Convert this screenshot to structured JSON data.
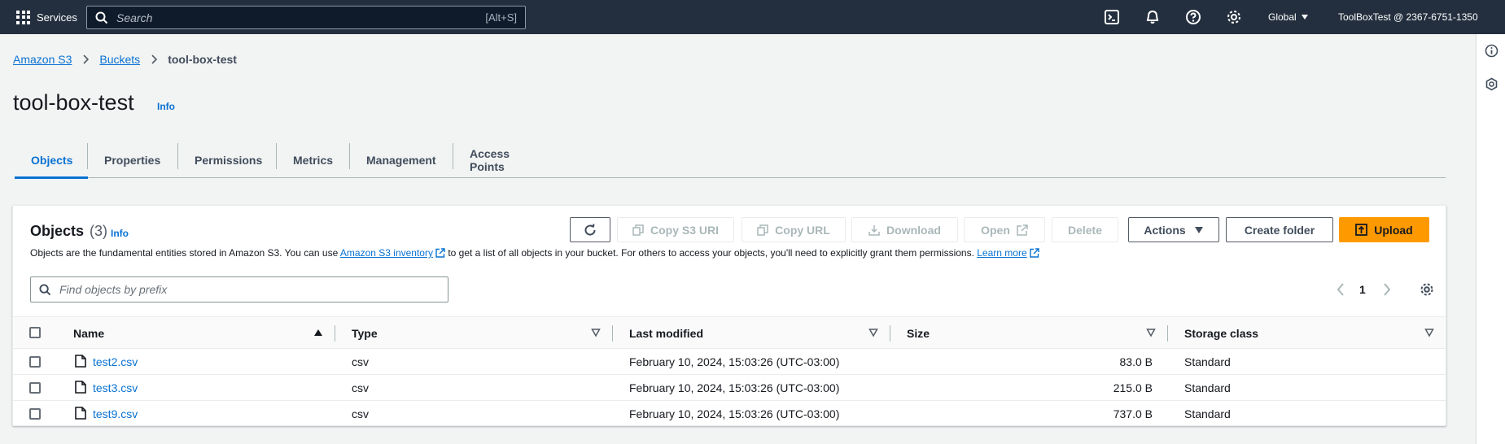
{
  "topnav": {
    "services_label": "Services",
    "search_placeholder": "Search",
    "search_shortcut": "[Alt+S]",
    "region": "Global",
    "account": "ToolBoxTest @ 2367-6751-1350"
  },
  "breadcrumb": {
    "items": [
      "Amazon S3",
      "Buckets"
    ],
    "current": "tool-box-test"
  },
  "page": {
    "title": "tool-box-test",
    "info": "Info"
  },
  "tabs": [
    "Objects",
    "Properties",
    "Permissions",
    "Metrics",
    "Management",
    "Access Points"
  ],
  "objects": {
    "title": "Objects",
    "count": "(3)",
    "info": "Info",
    "desc_1": "Objects are the fundamental entities stored in Amazon S3. You can use ",
    "desc_link": "Amazon S3 inventory",
    "desc_2": " to get a list of all objects in your bucket. For others to access your objects, you'll need to explicitly grant them permissions. ",
    "learn_more": "Learn more",
    "buttons": {
      "copy_uri": "Copy S3 URI",
      "copy_url": "Copy URL",
      "download": "Download",
      "open": "Open",
      "delete": "Delete",
      "actions": "Actions",
      "create_folder": "Create folder",
      "upload": "Upload"
    },
    "filter_placeholder": "Find objects by prefix",
    "page_number": "1",
    "columns": [
      "Name",
      "Type",
      "Last modified",
      "Size",
      "Storage class"
    ],
    "rows": [
      {
        "name": "test2.csv",
        "type": "csv",
        "modified": "February 10, 2024, 15:03:26 (UTC-03:00)",
        "size": "83.0 B",
        "storage": "Standard"
      },
      {
        "name": "test3.csv",
        "type": "csv",
        "modified": "February 10, 2024, 15:03:26 (UTC-03:00)",
        "size": "215.0 B",
        "storage": "Standard"
      },
      {
        "name": "test9.csv",
        "type": "csv",
        "modified": "February 10, 2024, 15:03:26 (UTC-03:00)",
        "size": "737.0 B",
        "storage": "Standard"
      }
    ]
  },
  "colors": {
    "nav_bg": "#232f3e",
    "link": "#0972d3",
    "primary": "#ff9900"
  }
}
